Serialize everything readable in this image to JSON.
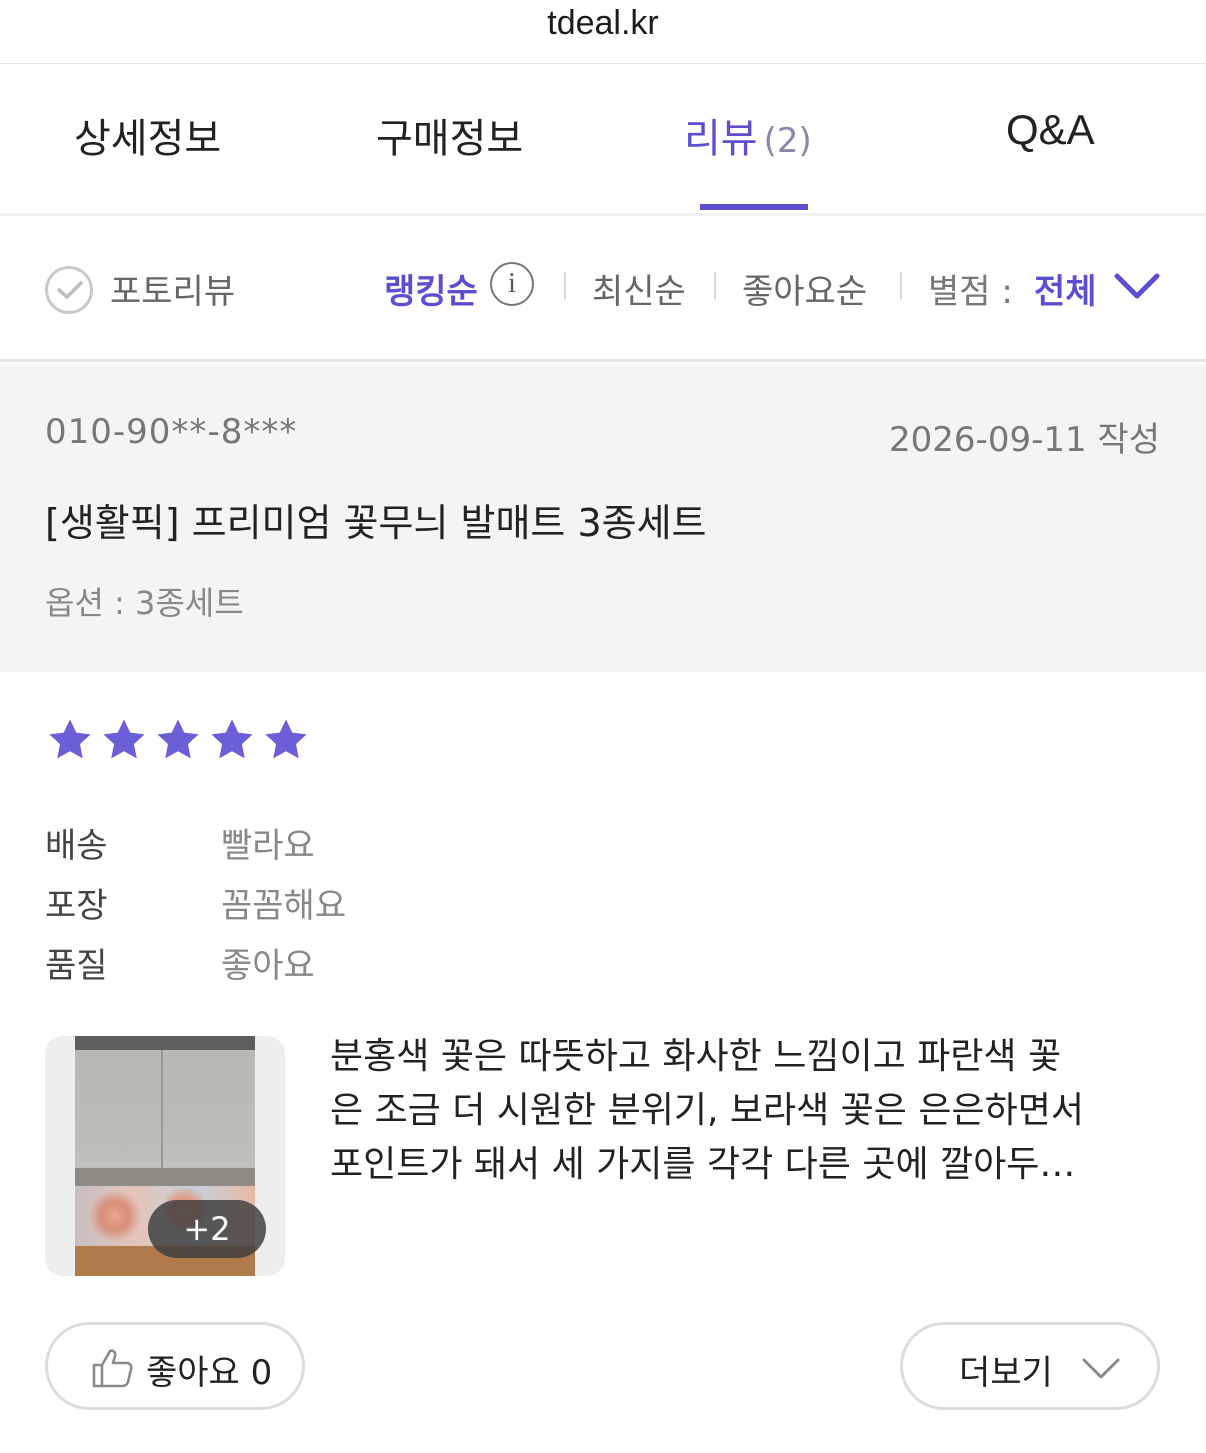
{
  "browser": {
    "url": "tdeal.kr"
  },
  "tabs": [
    {
      "label": "상세정보"
    },
    {
      "label": "구매정보"
    },
    {
      "label": "리뷰",
      "count": "(2)"
    },
    {
      "label": "Q&A"
    }
  ],
  "active_tab": "리뷰",
  "filters": {
    "photo_review": "포토리뷰",
    "sort_options": [
      "랭킹순",
      "최신순",
      "좋아요순"
    ],
    "active_sort": "랭킹순",
    "info_icon": "i",
    "rating_label": "별점 :",
    "rating_value": "전체"
  },
  "review": {
    "writer": "010-90**-8***",
    "date": "2026-09-11 작성",
    "product": "[생활픽] 프리미엄 꽃무늬 발매트 3종세트",
    "option": "옵션 : 3종세트",
    "rating": 5,
    "rating_max": 5,
    "attributes": [
      {
        "key": "배송",
        "value": "빨라요"
      },
      {
        "key": "포장",
        "value": "꼼꼼해요"
      },
      {
        "key": "품질",
        "value": "좋아요"
      }
    ],
    "extra_photos": "+2",
    "text_lines": [
      "분홍색 꽃은 따뜻하고 화사한 느낌이고 파란색 꽃",
      "은 조금 더 시원한 분위기, 보라색 꽃은 은은하면서",
      "포인트가 돼서 세 가지를 각각 다른 곳에 깔아두…"
    ],
    "like_label": "좋아요 0",
    "more_label": "더보기"
  },
  "colors": {
    "accent": "#5b4fd0",
    "star": "#6a5fd6",
    "header_bg": "#f4f4f4"
  },
  "icons": {
    "photo_check": "check-circle-icon",
    "info": "info-icon",
    "rating_dropdown": "chevron-down-icon",
    "like": "thumbs-up-icon",
    "more": "chevron-down-icon",
    "star": "star-icon"
  }
}
